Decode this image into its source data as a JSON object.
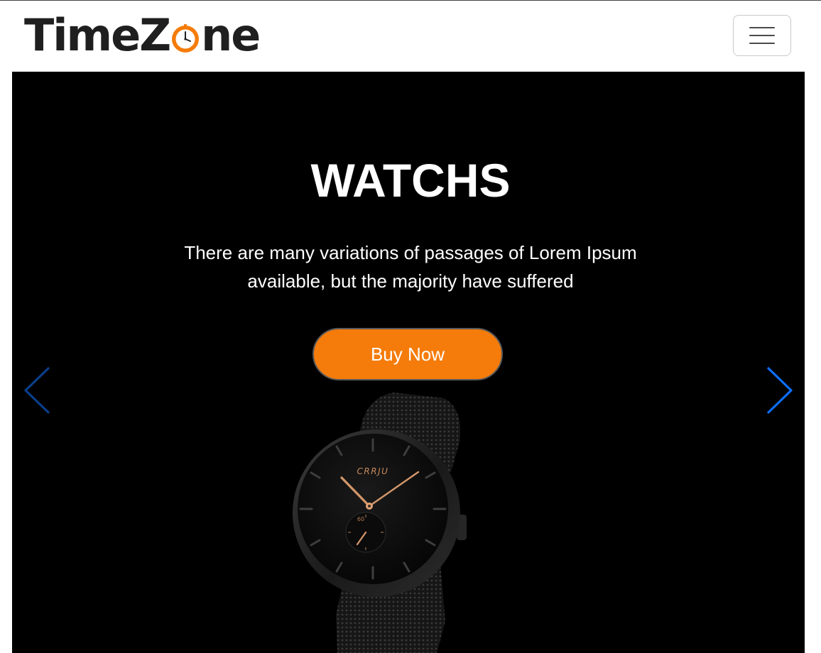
{
  "header": {
    "brand": {
      "part1": "TimeZ",
      "part2": "ne"
    },
    "menu_icon": "hamburger-menu-icon"
  },
  "hero": {
    "title": "WATCHS",
    "text": "There are many variations of passages of Lorem Ipsum available, but the majority have suffered",
    "cta_label": "Buy Now",
    "prev_icon": "chevron-left-icon",
    "next_icon": "chevron-right-icon",
    "watch_brand": "CRRJU",
    "subdial_label": "60"
  },
  "colors": {
    "accent": "#f57c0a",
    "hero_background": "#000000",
    "carousel_arrow": "#0d6efd",
    "text_dark": "#1f1f1f"
  }
}
